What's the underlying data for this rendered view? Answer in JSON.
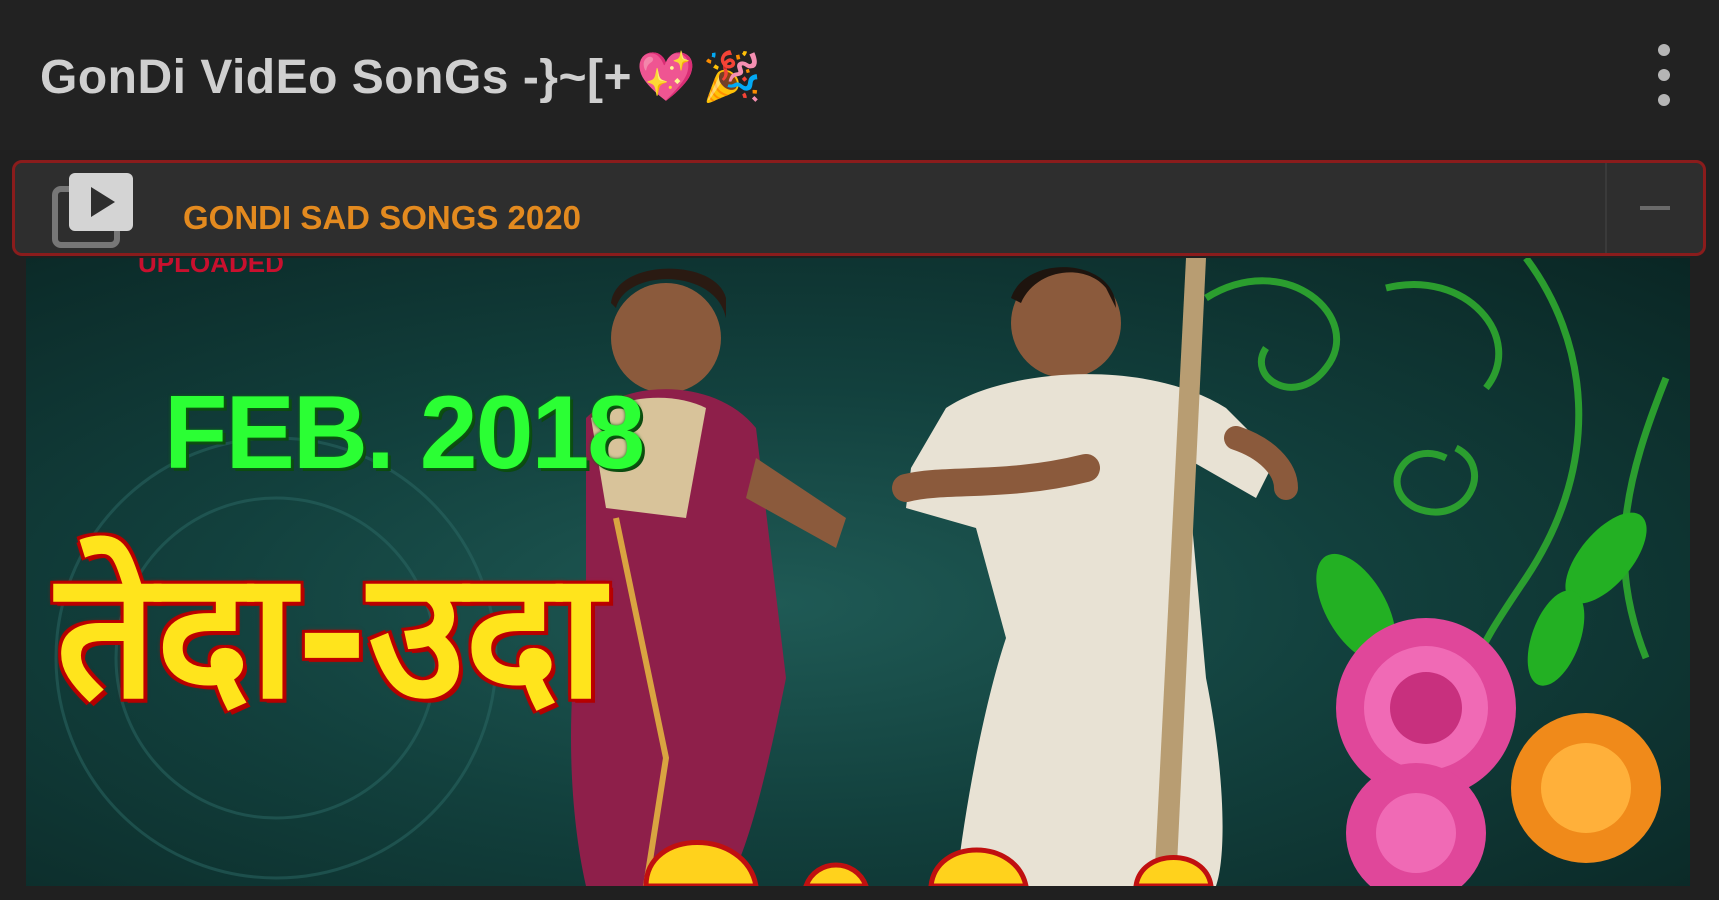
{
  "app_bar": {
    "title": "GonDi VidEo SonGs -}~[+",
    "title_heart": "💖",
    "title_popper": "🎉",
    "menu_icon": "more-vert-icon"
  },
  "playlist": {
    "icon": "playlist-play-icon",
    "title": "GONDI SAD SONGS 2020",
    "collapse_icon": "minus-icon",
    "title_color": "#e38a1f",
    "border_color": "#8a1c1c"
  },
  "thumbnail": {
    "badge": "UPLOADED",
    "date_text": "FEB. 2018",
    "title_text": "तेदा-उदा"
  }
}
